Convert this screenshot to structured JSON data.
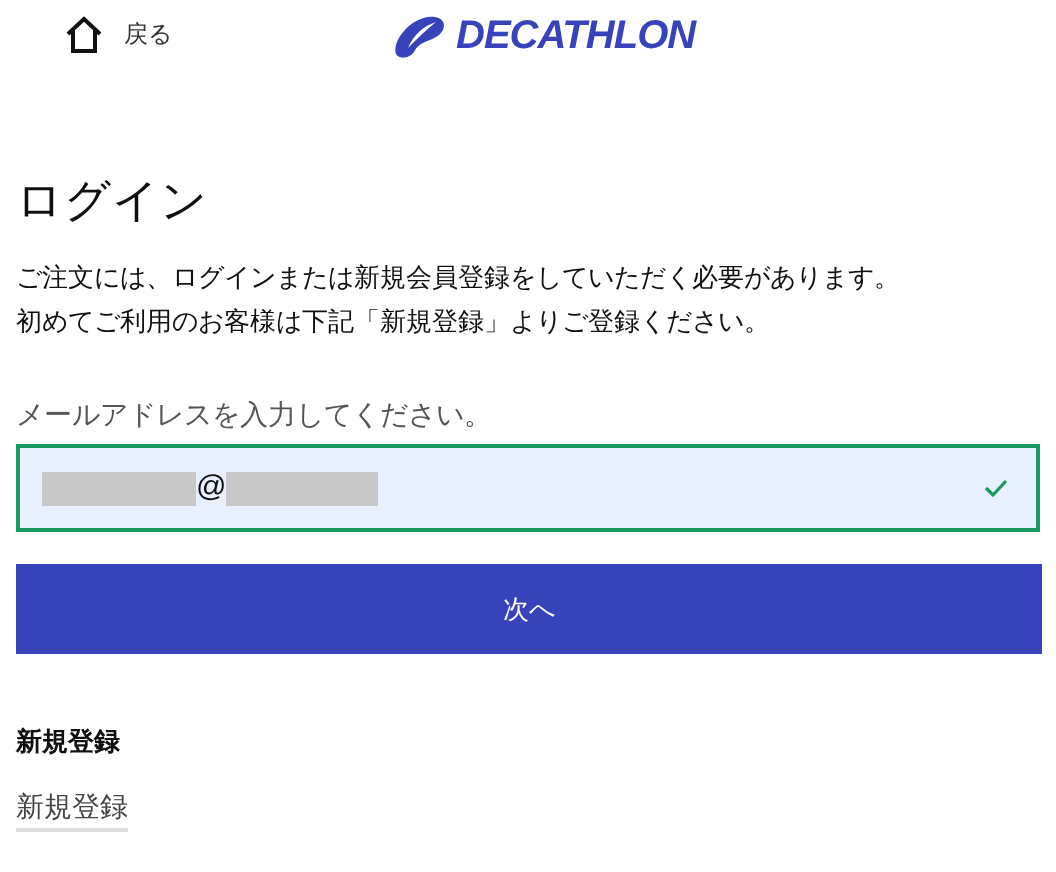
{
  "header": {
    "back_label": "戻る",
    "logo": "DECATHLON"
  },
  "title": "ログイン",
  "intro": [
    "ご注文には、ログインまたは新規会員登録をしていただく必要があります。",
    "初めてご利用のお客様は下記「新規登録」よりご登録ください。"
  ],
  "email": {
    "label": "メールアドレスを入力してください。",
    "value": "@",
    "valid": true
  },
  "next_button": "次へ",
  "register": {
    "heading": "新規登録",
    "link": "新規登録"
  }
}
